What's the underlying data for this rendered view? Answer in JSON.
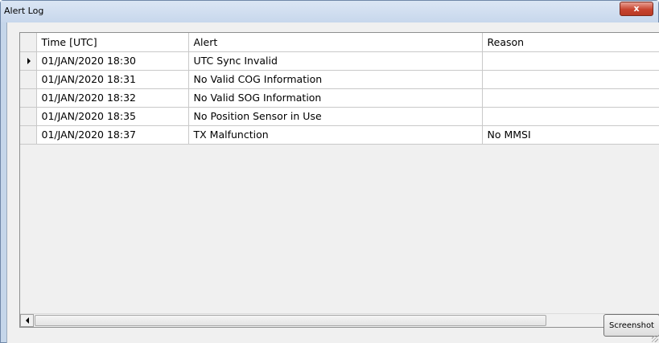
{
  "window": {
    "title": "Alert Log",
    "close_label": "x"
  },
  "table": {
    "columns": [
      "",
      "Time [UTC]",
      "Alert",
      "Reason"
    ],
    "rows": [
      {
        "time": "01/JAN/2020 18:30",
        "alert": "UTC Sync Invalid",
        "reason": ""
      },
      {
        "time": "01/JAN/2020 18:31",
        "alert": "No Valid COG Information",
        "reason": ""
      },
      {
        "time": "01/JAN/2020 18:32",
        "alert": "No Valid SOG Information",
        "reason": ""
      },
      {
        "time": "01/JAN/2020 18:35",
        "alert": "No Position Sensor in Use",
        "reason": ""
      },
      {
        "time": "01/JAN/2020 18:37",
        "alert": "TX Malfunction",
        "reason": "No MMSI"
      }
    ],
    "current_row_indicator": "triangle-right-icon"
  },
  "buttons": {
    "screenshot_label": "Screenshot"
  },
  "icons": {
    "close": "close-icon",
    "scroll_left": "scroll-left-icon",
    "scroll_right": "scroll-right-icon"
  }
}
